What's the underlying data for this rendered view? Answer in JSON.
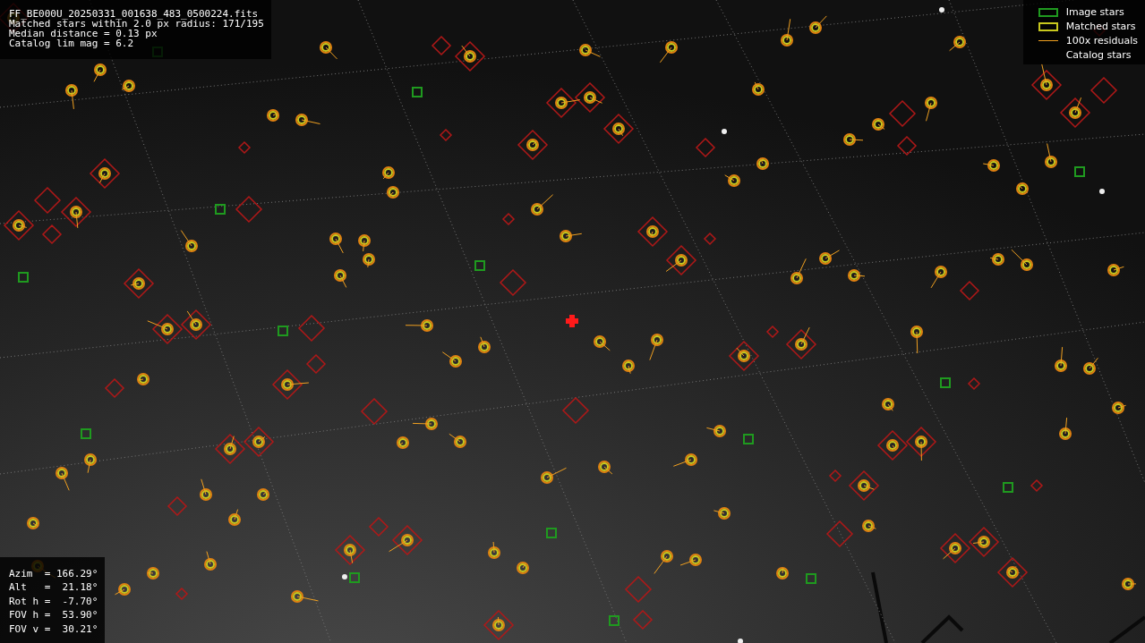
{
  "info_top": [
    "FF_BE000U_20250331_001638_483_0500224.fits",
    "Matched stars within 2.0 px radius: 171/195",
    "Median distance = 0.13 px",
    "Catalog lim mag = 6.2"
  ],
  "legend": [
    {
      "kind": "box",
      "color": "#1f9a1f",
      "label": "Image stars"
    },
    {
      "kind": "box",
      "color": "#c8c81e",
      "label": "Matched stars"
    },
    {
      "kind": "line",
      "color": "#f0a020",
      "label": "100x residuals"
    },
    {
      "kind": "none",
      "label": "Catalog stars"
    }
  ],
  "info_bottom": [
    "Azim  = 166.29°",
    "Alt   =  21.18°",
    "Rot h =  -7.70°",
    "FOV h =  53.90°",
    "FOV v =  30.21°"
  ]
}
